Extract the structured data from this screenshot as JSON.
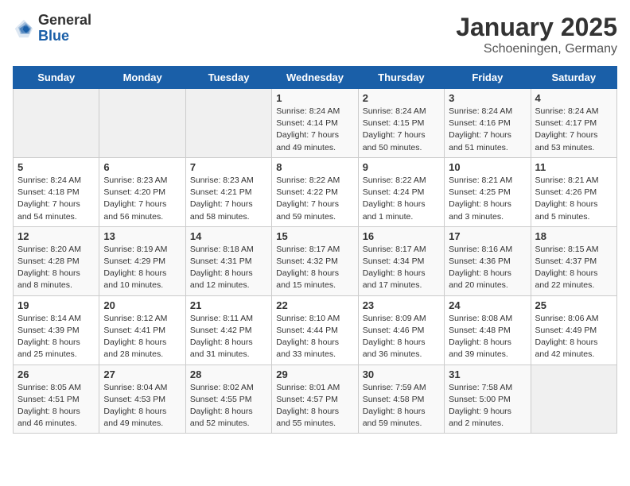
{
  "header": {
    "logo_general": "General",
    "logo_blue": "Blue",
    "month": "January 2025",
    "location": "Schoeningen, Germany"
  },
  "weekdays": [
    "Sunday",
    "Monday",
    "Tuesday",
    "Wednesday",
    "Thursday",
    "Friday",
    "Saturday"
  ],
  "weeks": [
    [
      {
        "day": "",
        "info": ""
      },
      {
        "day": "",
        "info": ""
      },
      {
        "day": "",
        "info": ""
      },
      {
        "day": "1",
        "info": "Sunrise: 8:24 AM\nSunset: 4:14 PM\nDaylight: 7 hours and 49 minutes."
      },
      {
        "day": "2",
        "info": "Sunrise: 8:24 AM\nSunset: 4:15 PM\nDaylight: 7 hours and 50 minutes."
      },
      {
        "day": "3",
        "info": "Sunrise: 8:24 AM\nSunset: 4:16 PM\nDaylight: 7 hours and 51 minutes."
      },
      {
        "day": "4",
        "info": "Sunrise: 8:24 AM\nSunset: 4:17 PM\nDaylight: 7 hours and 53 minutes."
      }
    ],
    [
      {
        "day": "5",
        "info": "Sunrise: 8:24 AM\nSunset: 4:18 PM\nDaylight: 7 hours and 54 minutes."
      },
      {
        "day": "6",
        "info": "Sunrise: 8:23 AM\nSunset: 4:20 PM\nDaylight: 7 hours and 56 minutes."
      },
      {
        "day": "7",
        "info": "Sunrise: 8:23 AM\nSunset: 4:21 PM\nDaylight: 7 hours and 58 minutes."
      },
      {
        "day": "8",
        "info": "Sunrise: 8:22 AM\nSunset: 4:22 PM\nDaylight: 7 hours and 59 minutes."
      },
      {
        "day": "9",
        "info": "Sunrise: 8:22 AM\nSunset: 4:24 PM\nDaylight: 8 hours and 1 minute."
      },
      {
        "day": "10",
        "info": "Sunrise: 8:21 AM\nSunset: 4:25 PM\nDaylight: 8 hours and 3 minutes."
      },
      {
        "day": "11",
        "info": "Sunrise: 8:21 AM\nSunset: 4:26 PM\nDaylight: 8 hours and 5 minutes."
      }
    ],
    [
      {
        "day": "12",
        "info": "Sunrise: 8:20 AM\nSunset: 4:28 PM\nDaylight: 8 hours and 8 minutes."
      },
      {
        "day": "13",
        "info": "Sunrise: 8:19 AM\nSunset: 4:29 PM\nDaylight: 8 hours and 10 minutes."
      },
      {
        "day": "14",
        "info": "Sunrise: 8:18 AM\nSunset: 4:31 PM\nDaylight: 8 hours and 12 minutes."
      },
      {
        "day": "15",
        "info": "Sunrise: 8:17 AM\nSunset: 4:32 PM\nDaylight: 8 hours and 15 minutes."
      },
      {
        "day": "16",
        "info": "Sunrise: 8:17 AM\nSunset: 4:34 PM\nDaylight: 8 hours and 17 minutes."
      },
      {
        "day": "17",
        "info": "Sunrise: 8:16 AM\nSunset: 4:36 PM\nDaylight: 8 hours and 20 minutes."
      },
      {
        "day": "18",
        "info": "Sunrise: 8:15 AM\nSunset: 4:37 PM\nDaylight: 8 hours and 22 minutes."
      }
    ],
    [
      {
        "day": "19",
        "info": "Sunrise: 8:14 AM\nSunset: 4:39 PM\nDaylight: 8 hours and 25 minutes."
      },
      {
        "day": "20",
        "info": "Sunrise: 8:12 AM\nSunset: 4:41 PM\nDaylight: 8 hours and 28 minutes."
      },
      {
        "day": "21",
        "info": "Sunrise: 8:11 AM\nSunset: 4:42 PM\nDaylight: 8 hours and 31 minutes."
      },
      {
        "day": "22",
        "info": "Sunrise: 8:10 AM\nSunset: 4:44 PM\nDaylight: 8 hours and 33 minutes."
      },
      {
        "day": "23",
        "info": "Sunrise: 8:09 AM\nSunset: 4:46 PM\nDaylight: 8 hours and 36 minutes."
      },
      {
        "day": "24",
        "info": "Sunrise: 8:08 AM\nSunset: 4:48 PM\nDaylight: 8 hours and 39 minutes."
      },
      {
        "day": "25",
        "info": "Sunrise: 8:06 AM\nSunset: 4:49 PM\nDaylight: 8 hours and 42 minutes."
      }
    ],
    [
      {
        "day": "26",
        "info": "Sunrise: 8:05 AM\nSunset: 4:51 PM\nDaylight: 8 hours and 46 minutes."
      },
      {
        "day": "27",
        "info": "Sunrise: 8:04 AM\nSunset: 4:53 PM\nDaylight: 8 hours and 49 minutes."
      },
      {
        "day": "28",
        "info": "Sunrise: 8:02 AM\nSunset: 4:55 PM\nDaylight: 8 hours and 52 minutes."
      },
      {
        "day": "29",
        "info": "Sunrise: 8:01 AM\nSunset: 4:57 PM\nDaylight: 8 hours and 55 minutes."
      },
      {
        "day": "30",
        "info": "Sunrise: 7:59 AM\nSunset: 4:58 PM\nDaylight: 8 hours and 59 minutes."
      },
      {
        "day": "31",
        "info": "Sunrise: 7:58 AM\nSunset: 5:00 PM\nDaylight: 9 hours and 2 minutes."
      },
      {
        "day": "",
        "info": ""
      }
    ]
  ]
}
